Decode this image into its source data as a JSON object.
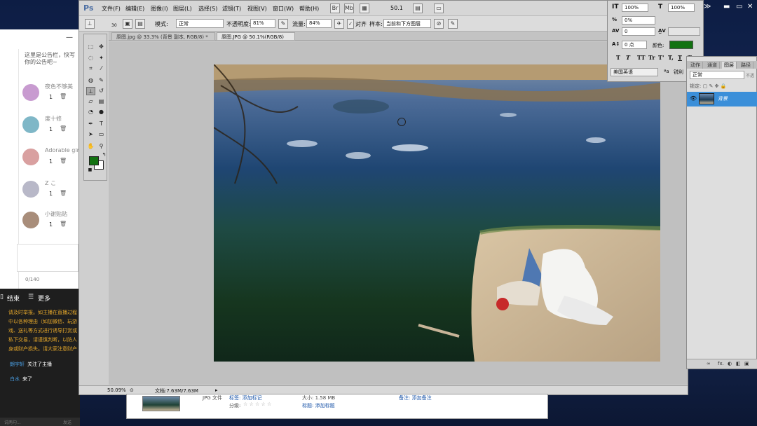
{
  "chat": {
    "note": "这里是公告栏，快写你的公告吧~",
    "users": [
      {
        "name": "夜色不够美",
        "count": "1",
        "avatar_color": "#c89bd0"
      },
      {
        "name": "度十修",
        "count": "1",
        "avatar_color": "#7fb7c7"
      },
      {
        "name": "Adorable girl",
        "count": "1",
        "avatar_color": "#d9a0a0"
      },
      {
        "name": "Z こ",
        "count": "1",
        "avatar_color": "#b8b8c8"
      },
      {
        "name": "小谢贴贴",
        "count": "1",
        "avatar_color": "#a88d7a"
      }
    ],
    "counter": "0/140",
    "end_label": "结束",
    "more_label": "更多",
    "warning": "请及时举报。如主播在直播过程中以各种理由（如加微信、玩游戏、送礼等方式进行诱导打赏或私下交易，请谨慎判断，以防人身或财产损失。请大家注意财产安全，谨防网络诈骗。",
    "messages": [
      {
        "user": "朗宇轩",
        "text": "关注了主播"
      },
      {
        "user": "白水",
        "text": "来了"
      }
    ],
    "input_placeholder": "说两句...",
    "send_label": "发送"
  },
  "ps": {
    "logo": "Ps",
    "menu": [
      "文件(F)",
      "编辑(E)",
      "图像(I)",
      "图层(L)",
      "选择(S)",
      "滤镜(T)",
      "视图(V)",
      "窗口(W)",
      "帮助(H)"
    ],
    "zoom_menu": "50.1",
    "options": {
      "brush_size": "30",
      "mode_label": "模式:",
      "mode_value": "正常",
      "opacity_label": "不透明度:",
      "opacity_value": "81%",
      "flow_label": "流量:",
      "flow_value": "84%",
      "aligned_label": "对齐",
      "sample_label": "样本:",
      "sample_value": "当前和下方图层"
    },
    "tabs": [
      "原图.jpg @ 33.3% (背景 副本, RGB/8) *",
      "原图.JPG @ 50.1%(RGB/8)"
    ],
    "status_zoom": "50.09%",
    "status_doc": "文档:7.63M/7.63M",
    "fg_color": "#127211"
  },
  "character": {
    "size1": "100%",
    "size2": "100%",
    "tracking": "0%",
    "kerning": "0",
    "baseline": "0 点",
    "color_label": "颜色:",
    "language": "美国英语",
    "aa_label": "锐利",
    "styles": [
      "T",
      "T",
      "TT",
      "Tr",
      "T'",
      "T,",
      "T",
      "T"
    ]
  },
  "layers": {
    "tabs": [
      "动作",
      "通道",
      "图层",
      "路径"
    ],
    "blend": "正常",
    "opacity_label": "不透",
    "lock_label": "锁定:",
    "layer_name": "背景",
    "bottom_icons": [
      "∞",
      "fx.",
      "◐",
      "◧",
      "▣",
      "🗑"
    ]
  },
  "bridge": {
    "file_type": "JPG 文件",
    "label_key": "标签: 添加标记",
    "rating_key": "分级:",
    "size_key": "大小: 1.58 MB",
    "title_key": "标题: 添加标题",
    "note_key": "备注: 添加备注"
  }
}
